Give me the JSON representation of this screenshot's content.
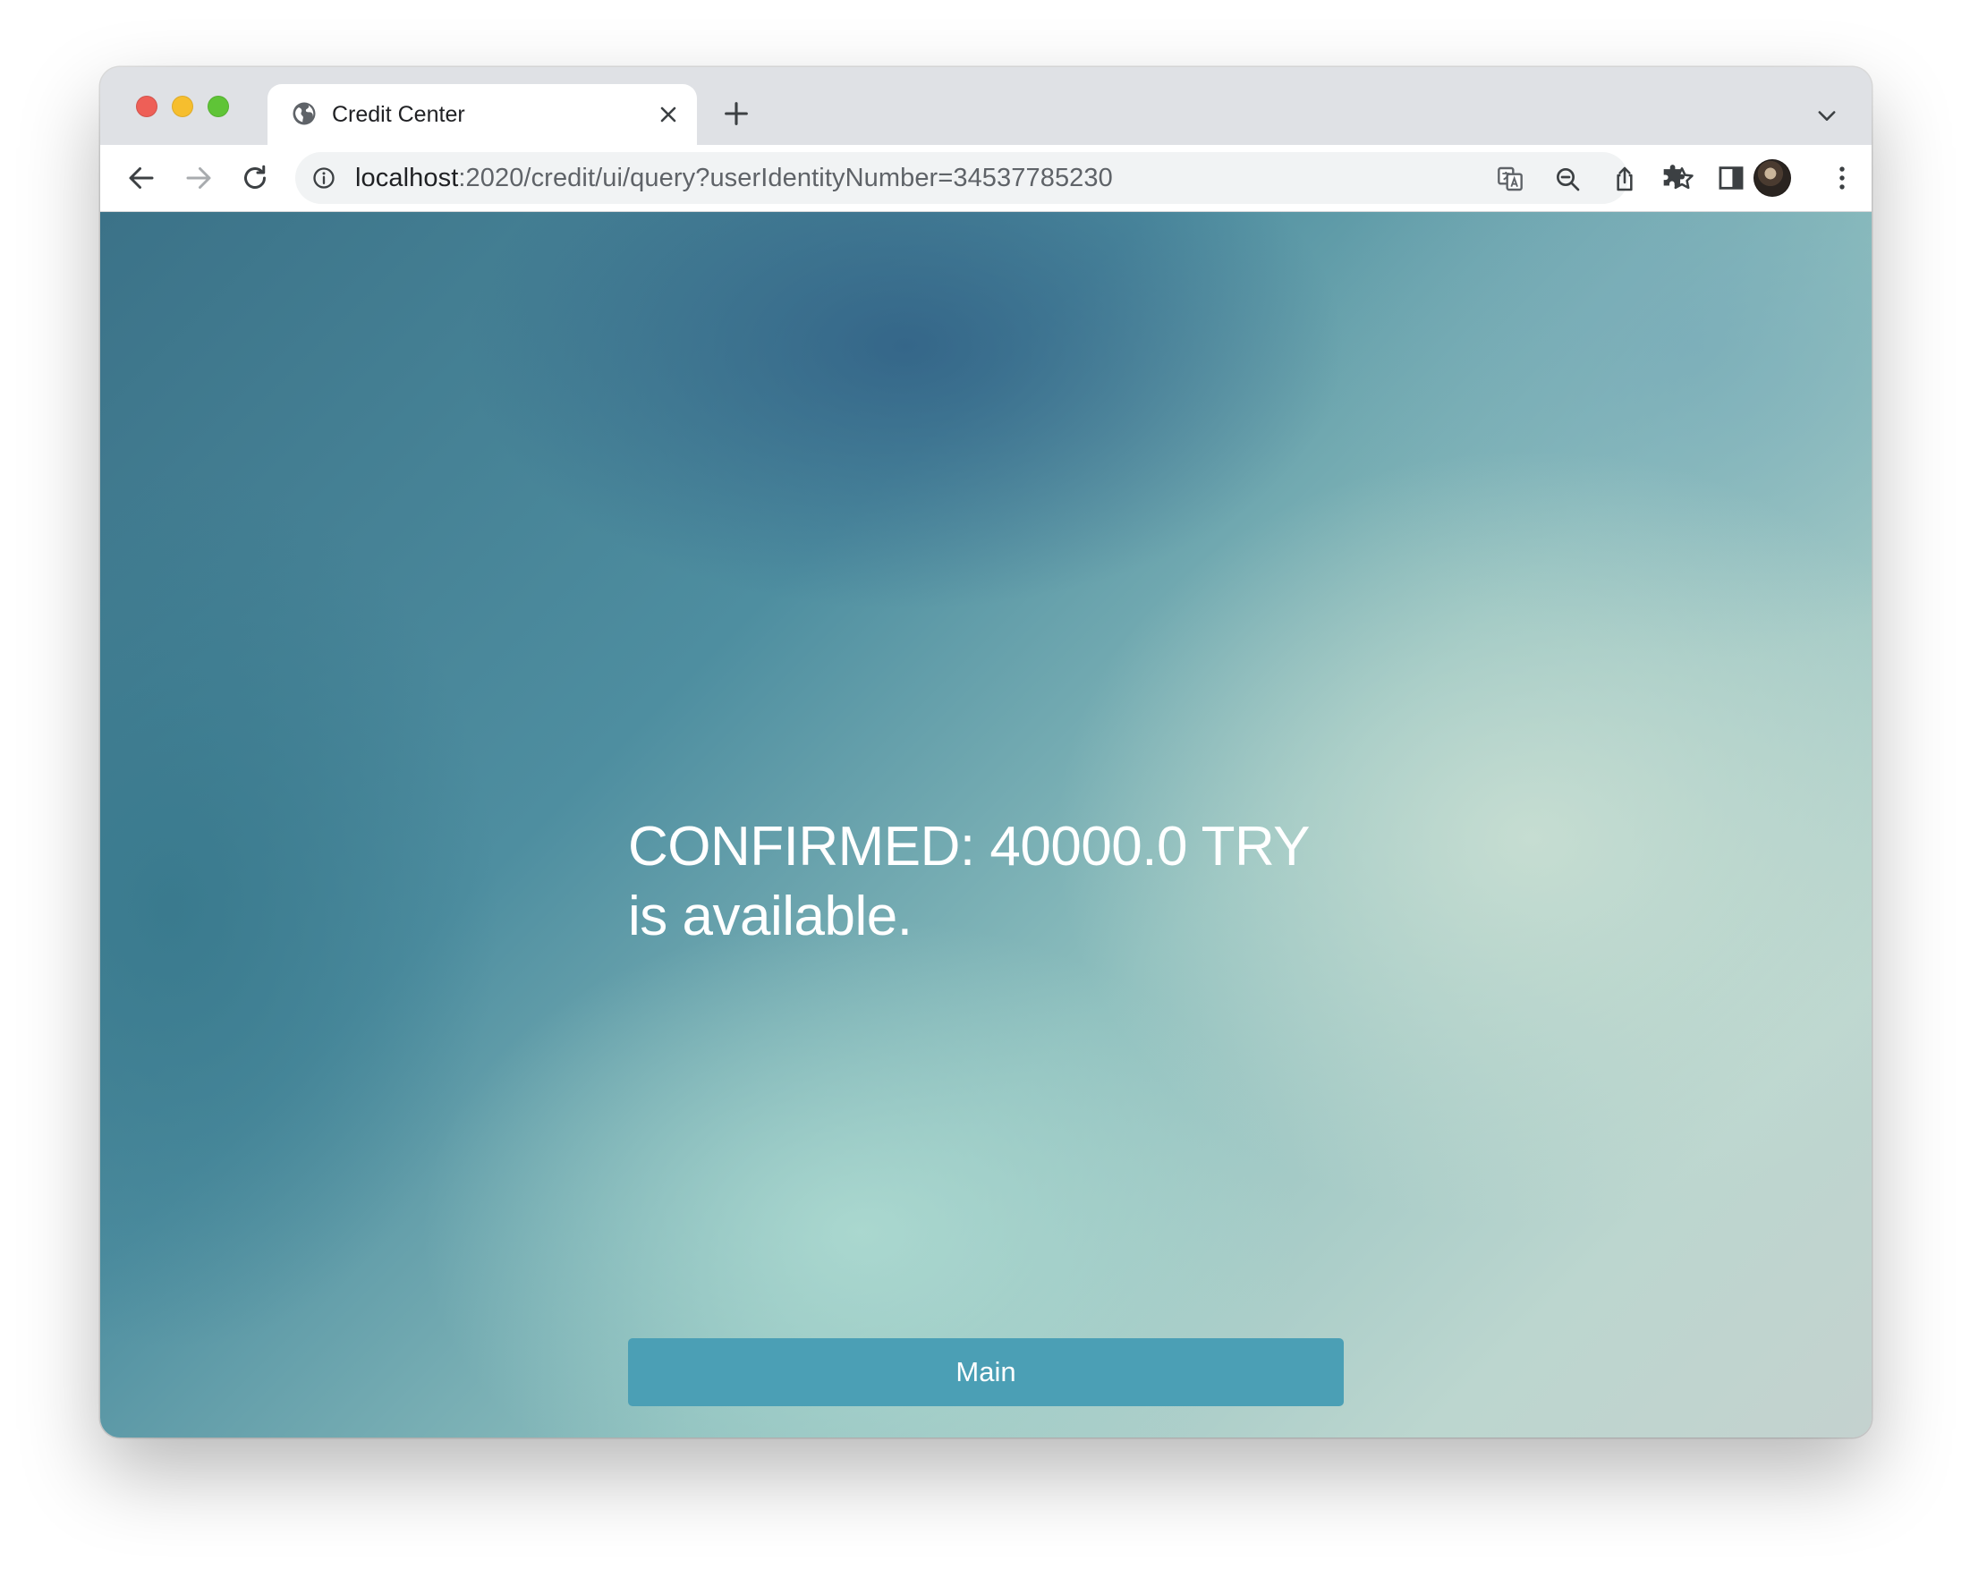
{
  "browser": {
    "tab": {
      "title": "Credit Center",
      "favicon": "globe-icon"
    },
    "address_bar": {
      "host": "localhost",
      "path": ":2020/credit/ui/query?userIdentityNumber=34537785230"
    },
    "icons": {
      "back": "arrow-left-icon",
      "forward": "arrow-right-icon",
      "reload": "reload-icon",
      "site_info": "info-icon",
      "translate": "translate-icon",
      "zoom": "zoom-out-icon",
      "share": "share-icon",
      "bookmark": "star-icon",
      "extensions": "puzzle-icon",
      "side_panel": "side-panel-icon",
      "menu": "kebab-menu-icon",
      "tab_list": "chevron-down-icon",
      "new_tab": "plus-icon",
      "close_tab": "close-icon"
    }
  },
  "page": {
    "message": "CONFIRMED: 40000.0 TRY is available.",
    "main_button_label": "Main"
  },
  "colors": {
    "button": "#4b9fb5",
    "text": "#ffffff",
    "traffic_red": "#ee5f57",
    "traffic_yellow": "#f6be2e",
    "traffic_green": "#5fc437"
  }
}
